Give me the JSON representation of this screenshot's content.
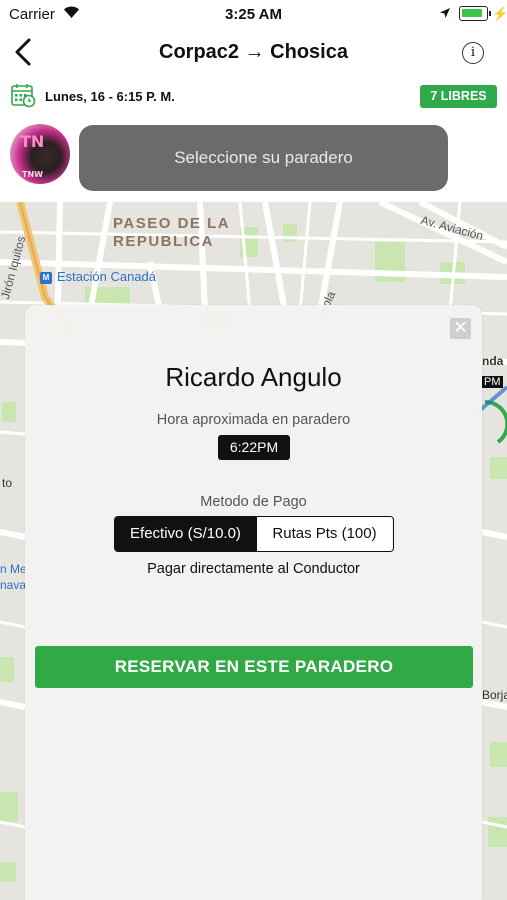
{
  "status_bar": {
    "carrier": "Carrier",
    "time": "3:25 AM",
    "battery_level": 0.85
  },
  "nav": {
    "title": "Corpac2 → Chosica"
  },
  "trip": {
    "date": "Lunes, 16 - 6:15 P. M.",
    "seats_badge": "7 LIBRES"
  },
  "driver_bar": {
    "avatar_text": "TN",
    "avatar_sub": "TNW",
    "select_stop": "Seleccione su paradero"
  },
  "map": {
    "labels": {
      "paseo_line1": "PASEO DE LA",
      "paseo_line2": "REPUBLICA",
      "aviacion": "Av. Aviación",
      "estacion": "Estación Canadá",
      "metro_icon": "M",
      "iquitos": "Jirón Iquitos",
      "riola": "rriola",
      "edge_nda": "nda",
      "edge_pm": "PM",
      "edge_to": "to",
      "edge_me": "n Me",
      "edge_nava": "nava",
      "edge_borja": "Borja"
    },
    "colors": {
      "base": "#e6e4df",
      "road": "#ffffff",
      "park": "#c9e5b0",
      "highway": "#f1c476",
      "route": "#2c70c9"
    }
  },
  "reservation_card": {
    "driver_name": "Ricardo Angulo",
    "approx_time_label": "Hora aproximada en paradero",
    "approx_time": "6:22PM",
    "payment_label": "Metodo de Pago",
    "payment_options": [
      {
        "label": "Efectivo (S/10.0)",
        "selected": true
      },
      {
        "label": "Rutas Pts (100)",
        "selected": false
      }
    ],
    "payment_note": "Pagar directamente al Conductor",
    "reserve_button": "RESERVAR EN ESTE PARADERO",
    "close_icon": "✕"
  },
  "colors": {
    "accent_green": "#31a944",
    "badge_green": "#2faa4a",
    "select_grey": "#6b6b6b"
  }
}
